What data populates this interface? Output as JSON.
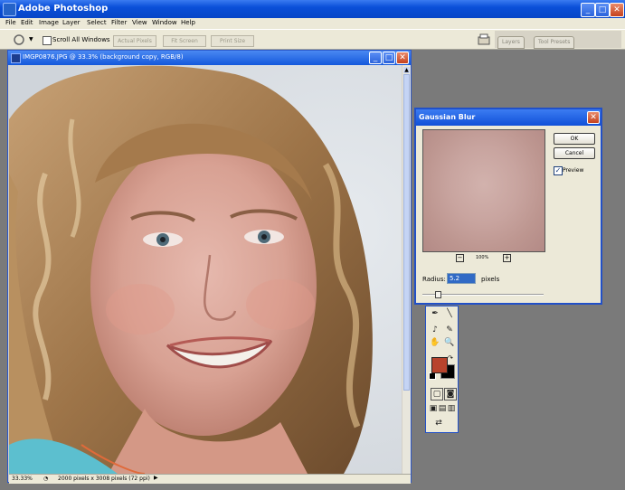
{
  "app": {
    "title": "Adobe Photoshop"
  },
  "menu": [
    "File",
    "Edit",
    "Image",
    "Layer",
    "Select",
    "Filter",
    "View",
    "Window",
    "Help"
  ],
  "options": {
    "scroll_all_label": "Scroll All Windows",
    "actual_pixels": "Actual Pixels",
    "fit_screen": "Fit Screen",
    "print_size": "Print Size"
  },
  "palette_tabs": [
    "Layers",
    "Tool Presets"
  ],
  "document": {
    "title": "IMGP0876.JPG @ 33.3% (background copy, RGB/8)",
    "status_zoom": "33.33%",
    "status_info": "2000 pixels x 3008 pixels (72 ppi)"
  },
  "blur_dialog": {
    "title": "Gaussian Blur",
    "ok": "OK",
    "cancel": "Cancel",
    "preview_label": "Preview",
    "preview_checked": true,
    "zoom": "100%",
    "radius_label": "Radius:",
    "radius_value": "5.2",
    "radius_unit": "pixels",
    "radius_level": 0.13
  },
  "colors": {
    "foreground": "#b8432c",
    "background": "#000000",
    "xp_blue": "#0a4fd8"
  }
}
